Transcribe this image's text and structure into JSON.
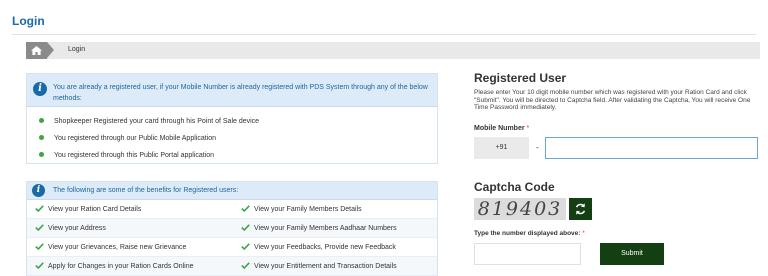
{
  "page": {
    "title": "Login"
  },
  "breadcrumb": {
    "icon": "home-icon",
    "current": "Login"
  },
  "registered_info": {
    "icon": "info-icon",
    "intro": "You are already a registered user, if your Mobile Number is already registered with PDS System through any of the below methods:",
    "methods": [
      "Shopkeeper Registered your card through his Point of Sale device",
      "You registered through our Public Mobile Application",
      "You registered through this Public Portal application"
    ],
    "bullet_color": "#3ea446"
  },
  "benefits": {
    "icon": "info-icon",
    "title": "The following are some of the benefits for Registered users:",
    "check_icon": "checkmark-icon",
    "check_color": "#3ea446",
    "rows": [
      [
        "View your Ration Card Details",
        "View your Family Members Details"
      ],
      [
        "View your Address",
        "View your Family Members Aadhaar Numbers"
      ],
      [
        "View your Grievances, Raise new Grievance",
        "View your Feedbacks, Provide new Feedback"
      ],
      [
        "Apply for Changes in your Ration Cards Online",
        "View your Entitlement and Transaction Details"
      ]
    ]
  },
  "registered_user": {
    "title": "Registered User",
    "description": "Please enter Your 10 digit mobile number which was registered with your Ration Card and click \"Submit\". You will be directed to Captcha field. After validating the Captcha, You will receive One Time Password immediately.",
    "mobile_label": "Mobile Number",
    "required_mark": "*",
    "prefix": "+91",
    "separator": "-",
    "mobile_value": ""
  },
  "captcha": {
    "title": "Captcha Code",
    "code": "819403",
    "refresh_icon": "refresh-icon",
    "input_label": "Type the number displayed above:",
    "required_mark": "*",
    "input_value": "",
    "submit_label": "Submit"
  },
  "colors": {
    "title_blue": "#1a6aa8",
    "info_bg": "#dcebf7",
    "button_green": "#133f13",
    "input_border": "#6aa6da"
  }
}
